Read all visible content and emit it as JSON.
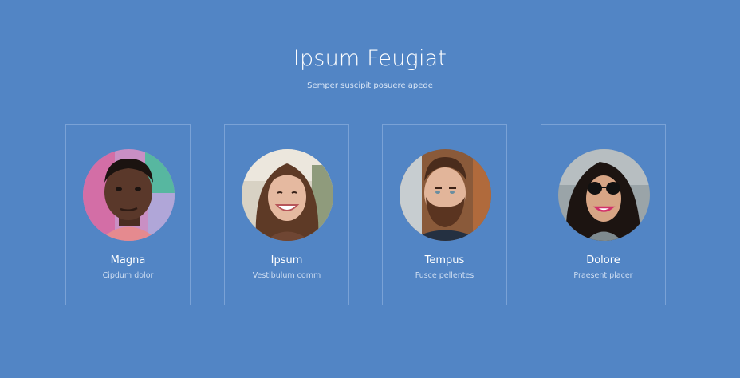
{
  "section": {
    "title": "Ipsum Feugiat",
    "subtitle": "Semper suscipit posuere apede"
  },
  "team": [
    {
      "name": "Magna",
      "role": "Cipdum dolor"
    },
    {
      "name": "Ipsum",
      "role": "Vestibulum comm"
    },
    {
      "name": "Tempus",
      "role": "Fusce pellentes"
    },
    {
      "name": "Dolore",
      "role": "Praesent placer"
    }
  ],
  "colors": {
    "background": "#5285c5",
    "card_border": "#7aa2d6",
    "text": "#ffffff"
  }
}
